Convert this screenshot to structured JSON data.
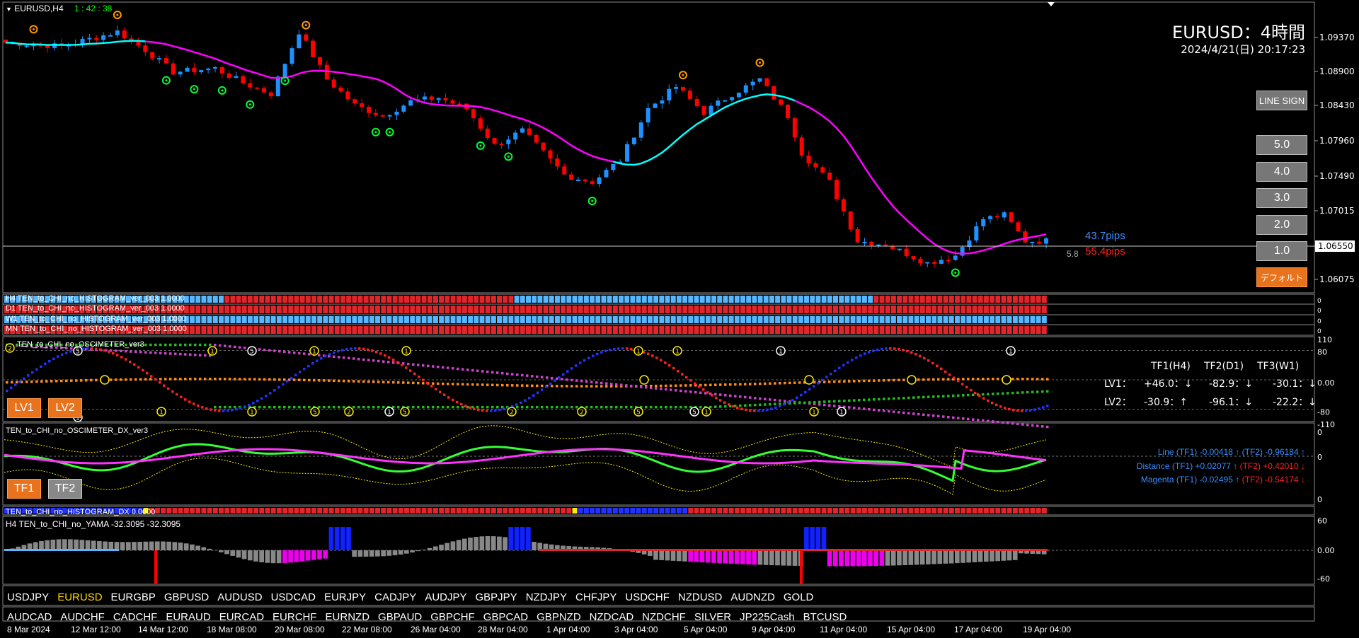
{
  "chart": {
    "symbol_tf": "EURUSD,H4",
    "countdown": "1 : 42 : 38",
    "title": "EURUSD：4時間",
    "datetime": "2024/4/21(日) 20:17:23",
    "current_price": "1.06550",
    "pips_blue": "43.7pips",
    "pips_red": "55.4pips",
    "spread": "5.8",
    "price_axis": [
      "1.09370",
      "1.08900",
      "1.08430",
      "1.07960",
      "1.07490",
      "1.07015",
      "1.06550",
      "1.06075"
    ],
    "time_axis": [
      "8 Mar 2024",
      "12 Mar 12:00",
      "14 Mar 12:00",
      "18 Mar 08:00",
      "20 Mar 08:00",
      "22 Mar 08:00",
      "26 Mar 04:00",
      "28 Mar 04:00",
      "1 Apr 04:00",
      "3 Apr 04:00",
      "5 Apr 04:00",
      "9 Apr 04:00",
      "11 Apr 04:00",
      "15 Apr 04:00",
      "17 Apr 04:00",
      "19 Apr 04:00"
    ],
    "colors": {
      "bull": "#1e90ff",
      "bear": "#ff0000",
      "ma_magenta": "#ff00ff",
      "ma_cyan": "#00ffff",
      "accent": "#e8731c"
    }
  },
  "buttons": {
    "line_sign": "LINE SIGN",
    "levels": [
      "5.0",
      "4.0",
      "3.0",
      "2.0",
      "1.0"
    ],
    "default": "デフォルト",
    "lv1": "LV1",
    "lv2": "LV2",
    "tf1": "TF1",
    "tf2": "TF2"
  },
  "histograms": [
    {
      "label": "H4 TEN_to_CHI_no_HISTOGRAM_ver_003 1.0000"
    },
    {
      "label": "D1 TEN_to_CHI_no_HISTOGRAM_ver_003 1.0000"
    },
    {
      "label": "W1 TEN_to_CHI_no_HISTOGRAM_ver_003 1.0000"
    },
    {
      "label": "MN TEN_to_CHI_no_HISTOGRAM_ver_003 1.0000"
    }
  ],
  "oscimeter": {
    "label": "TEN_to_CHI_no_OSCIMETER_ver3",
    "axis": [
      "110",
      "80",
      "0.00",
      "-80",
      "-110"
    ],
    "headers": [
      "TF1(H4)",
      "TF2(D1)",
      "TF3(W1)"
    ],
    "lv1": {
      "label": "LV1：",
      "tf1": "+46.0：↓",
      "tf2": "-82.9：↓",
      "tf3": "-30.1：↓"
    },
    "lv2": {
      "label": "LV2：",
      "tf1": "-30.9：↑",
      "tf2": "-96.1：↓",
      "tf3": "-22.2：↓"
    }
  },
  "oscimeter_dx": {
    "label": "TEN_to_CHI_no_OSCIMETER_DX_ver3",
    "axis": [
      "0",
      "0",
      "0"
    ],
    "line": {
      "name": "Line",
      "tf1": "(TF1) -0.00418 ↑",
      "tf2": "(TF2) -0.96184 ↑"
    },
    "distance": {
      "name": "Distance",
      "tf1": "(TF1) +0.02077 ↑",
      "tf2": "(TF2) +0.42010 ↓"
    },
    "magenta": {
      "name": "Magenta",
      "tf1": "(TF1) -0.02495 ↑",
      "tf2": "(TF2) -0.54174 ↓"
    }
  },
  "histogram_dx": {
    "label": "TEN_to_CHI_no_HISTOGRAM_DX 0.0000"
  },
  "yama": {
    "label": "H4  TEN_to_CHI_no_YAMA -32.3095 -32.3095",
    "axis": [
      "60",
      "0.00",
      "-60"
    ]
  },
  "symbols_row1": [
    "USDJPY",
    "EURUSD",
    "EURGBP",
    "GBPUSD",
    "AUDUSD",
    "USDCAD",
    "EURJPY",
    "CADJPY",
    "AUDJPY",
    "GBPJPY",
    "NZDJPY",
    "CHFJPY",
    "USDCHF",
    "NZDUSD",
    "AUDNZD",
    "GOLD"
  ],
  "symbols_row2": [
    "AUDCAD",
    "AUDCHF",
    "CADCHF",
    "EURAUD",
    "EURCAD",
    "EURCHF",
    "EURNZD",
    "GBPAUD",
    "GBPCHF",
    "GBPCAD",
    "GBPNZD",
    "NZDCAD",
    "NZDCHF",
    "SILVER",
    "JP225Cash",
    "BTCUSD"
  ],
  "active_symbol": "EURUSD"
}
